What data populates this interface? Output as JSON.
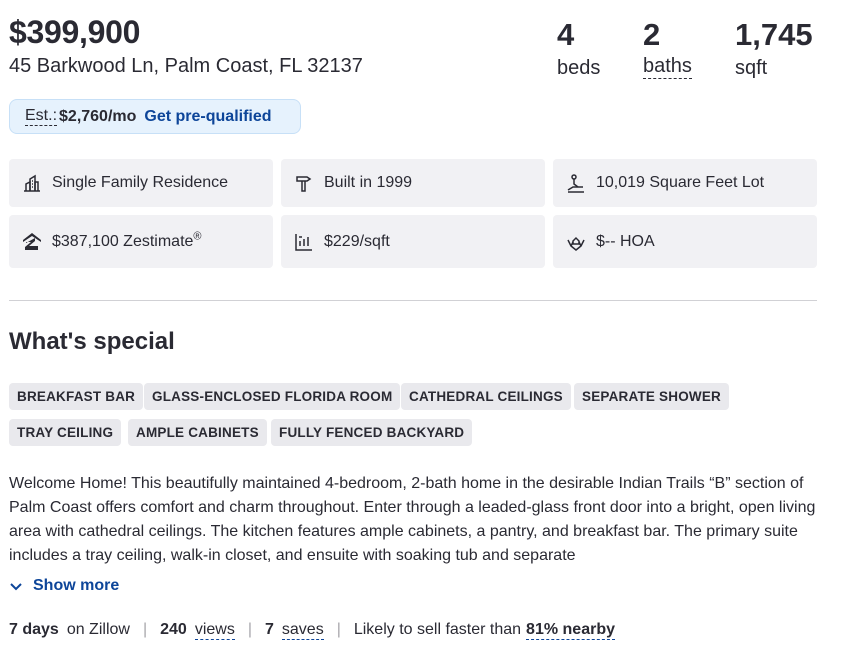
{
  "listing": {
    "price": "$399,900",
    "address": "45 Barkwood Ln, Palm Coast, FL 32137"
  },
  "stats": {
    "beds_num": "4",
    "beds_label": "beds",
    "baths_num": "2",
    "baths_label": "baths",
    "sqft_num": "1,745",
    "sqft_label": "sqft"
  },
  "estimate": {
    "label": "Est.:",
    "value": "$2,760/mo",
    "cta": "Get pre-qualified"
  },
  "facts": {
    "type": "Single Family Residence",
    "built": "Built in 1999",
    "lot": "10,019 Square Feet Lot",
    "zestimate": "$387,100 Zestimate",
    "zestimate_mark": "®",
    "price_per_sqft": "$229/sqft",
    "hoa": "$-- HOA"
  },
  "special": {
    "title": "What's special",
    "tags": [
      "BREAKFAST BAR",
      "GLASS-ENCLOSED FLORIDA ROOM",
      "CATHEDRAL CEILINGS",
      "SEPARATE SHOWER",
      "TRAY CEILING",
      "AMPLE CABINETS",
      "FULLY FENCED BACKYARD"
    ],
    "description": "Welcome Home! This beautifully maintained 4-bedroom, 2-bath home in the desirable Indian Trails “B” section of Palm Coast offers comfort and charm throughout. Enter through a leaded-glass front door into a bright, open living area with cathedral ceilings. The kitchen features ample cabinets, a pantry, and breakfast bar. The primary suite includes a tray ceiling, walk-in closet, and ensuite with soaking tub and separate",
    "show_more": "Show more"
  },
  "activity": {
    "days_value": "7 days",
    "days_label": "on Zillow",
    "views_value": "240",
    "views_label": "views",
    "saves_value": "7",
    "saves_label": "saves",
    "sell_text": "Likely to sell faster than",
    "sell_value": "81% nearby",
    "separator": "|"
  },
  "colors": {
    "text": "#2a2a33",
    "link": "#0d4599",
    "estimate_bg": "#e6f2fd",
    "fact_bg": "#f1f1f4",
    "tag_bg": "#e9e9ed"
  },
  "icons": {
    "type": "building-chart-icon",
    "built": "hammer-icon",
    "lot": "lot-measure-icon",
    "zestimate": "zillow-logo-icon",
    "price_per_sqft": "price-per-sqft-icon",
    "hoa": "hands-house-icon",
    "show_more": "chevron-down-icon"
  }
}
